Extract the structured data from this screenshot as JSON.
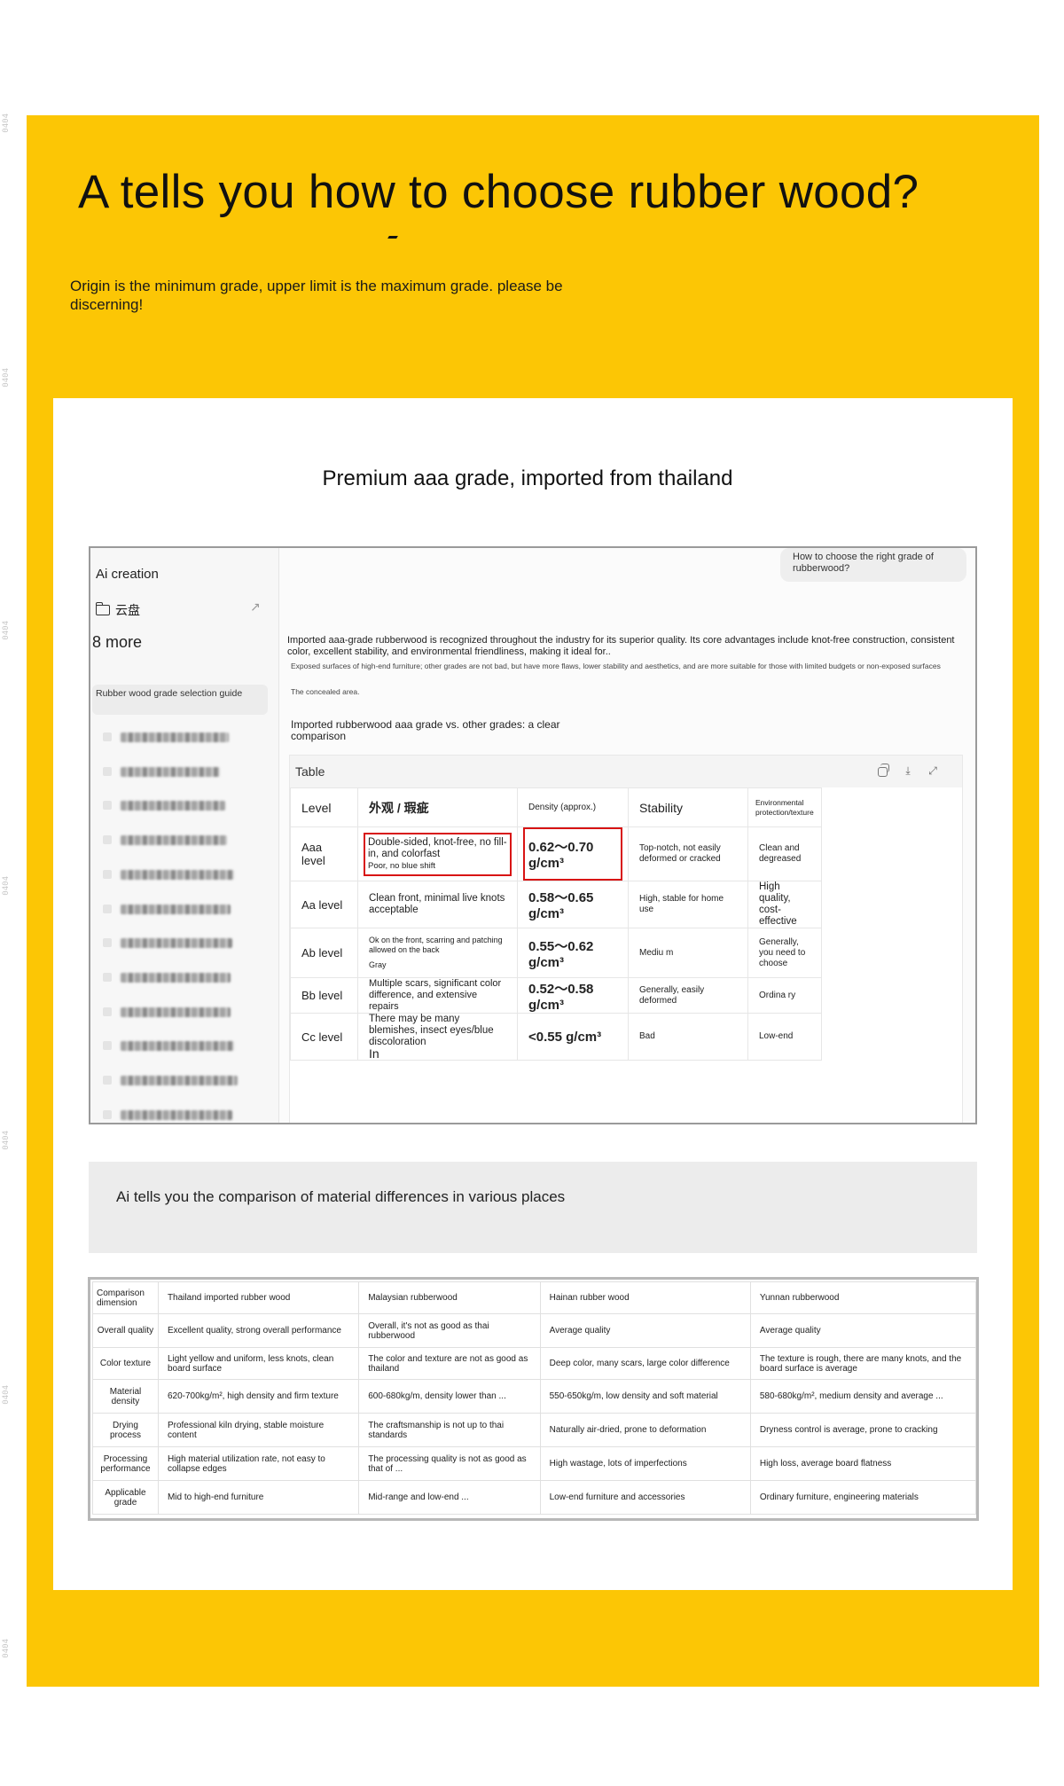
{
  "side_marks": [
    "0404",
    "0404",
    "0404",
    "0404",
    "0404",
    "0404",
    "0404"
  ],
  "hero": {
    "title": "A tells you how to choose rubber wood?",
    "subtitle": "Origin is the minimum grade, upper limit is the maximum grade. please be discerning!"
  },
  "section": {
    "heading": "Premium aaa grade, imported from thailand"
  },
  "sidebar": {
    "brand": "Ai creation",
    "cloud": "云盘",
    "more": "8 more",
    "active_item": "Rubber wood grade selection guide",
    "history_count": 12
  },
  "chat": {
    "question": "How to choose the right grade of rubberwood?",
    "answer_main": "Imported aaa-grade rubberwood is recognized throughout the industry for its superior quality. Its core advantages include knot-free construction, consistent color, excellent stability, and environmental friendliness, making it ideal for..",
    "answer_sub": "Exposed surfaces of high-end furniture; other grades are not bad, but have more flaws, lower stability and aesthetics, and are more suitable for those with limited budgets or non-exposed surfaces",
    "answer_small": "The concealed area.",
    "compare_title": "Imported rubberwood aaa grade vs. other grades: a clear comparison"
  },
  "grade_table": {
    "label": "Table",
    "headers": [
      "Level",
      "外观 / 瑕疵",
      "Density (approx.)",
      "Stability",
      "Environmental protection/texture"
    ],
    "rows": [
      [
        "Aaa level",
        "Double-sided, knot-free, no fill-in, and colorfast",
        "0.62～0.70 g/cm³",
        "Top-notch, not easily deformed or cracked",
        "Clean and degreased"
      ],
      [
        "Aa level",
        "Clean front, minimal live knots acceptable",
        "0.58～0.65 g/cm³",
        "High, stable for home use",
        "High quality, cost-effective"
      ],
      [
        "Ab level",
        "Ok on the front, scarring and patching allowed on the back",
        "0.55～0.62 g/cm³",
        "Mediu m",
        "Generally, you need to choose"
      ],
      [
        "Bb level",
        "Multiple scars, significant color difference, and extensive repairs",
        "0.52～0.58 g/cm³",
        "Generally, easily deformed",
        "Ordina ry"
      ],
      [
        "Cc level",
        "There may be many blemishes, insect eyes/blue discoloration",
        "<0.55 g/cm³",
        "Bad",
        "Low-end"
      ]
    ],
    "aaa_desc_extra": "Poor, no blue shift",
    "ab_desc_extra": "Gray",
    "cc_desc_extra": "In"
  },
  "gray_box": {
    "text": "Ai tells you the comparison of material differences in various places"
  },
  "comparison": {
    "headers": [
      "Comparison dimension",
      "Thailand imported rubber wood",
      "Malaysian rubberwood",
      "Hainan rubber wood",
      "Yunnan rubberwood"
    ],
    "rows": [
      [
        "Overall quality",
        "Excellent quality, strong overall performance",
        "Overall, it's not as good as thai rubberwood",
        "Average quality",
        "Average quality"
      ],
      [
        "Color texture",
        "Light yellow and uniform, less knots, clean board surface",
        "The color and texture are not as good as thailand",
        "Deep color, many scars, large color difference",
        "The texture is rough, there are many knots, and the board surface is average"
      ],
      [
        "Material density",
        "620-700kg/m², high density and firm texture",
        "600-680kg/m, density lower than ...",
        "550-650kg/m, low density and soft material",
        "580-680kg/m², medium density and average ..."
      ],
      [
        "Drying process",
        "Professional kiln drying, stable moisture content",
        "The craftsmanship is not up to thai standards",
        "Naturally air-dried, prone to deformation",
        "Dryness control is average, prone to cracking"
      ],
      [
        "Processing performance",
        "High material utilization rate, not easy to collapse edges",
        "The processing quality is not as good as that of ...",
        "High wastage, lots of imperfections",
        "High loss, average board flatness"
      ],
      [
        "Applicable grade",
        "Mid to high-end furniture",
        "Mid-range and low-end ...",
        "Low-end furniture and accessories",
        "Ordinary furniture, engineering materials"
      ]
    ]
  },
  "colors": {
    "panel_yellow": "#fcc605",
    "highlight_red": "#d81414",
    "gray_box": "#ececec"
  },
  "icons": [
    "folder-icon",
    "arrow-up-right-icon",
    "copy-icon",
    "download-icon",
    "expand-icon"
  ]
}
